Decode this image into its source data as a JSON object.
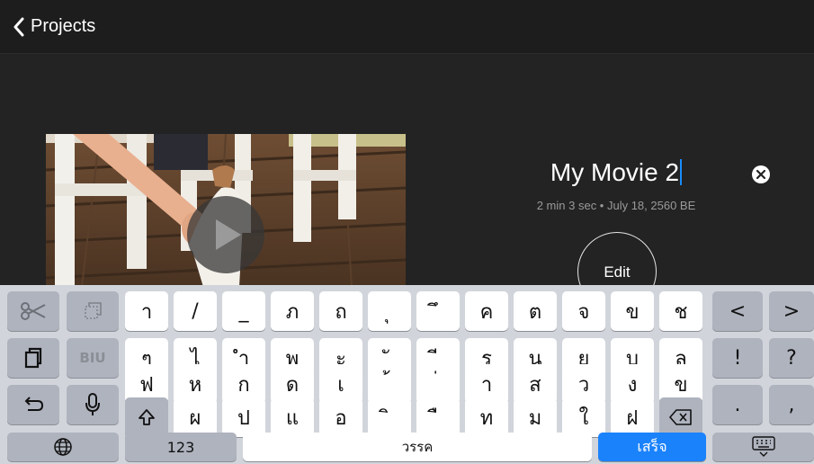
{
  "nav": {
    "back_label": "Projects"
  },
  "project": {
    "title": "My Movie 2",
    "meta": "2 min 3 sec • July 18, 2560 BE",
    "edit_label": "Edit"
  },
  "keyboard": {
    "rows": [
      [
        "า",
        "/",
        "_",
        "ภ",
        "ถ",
        "ุ",
        "ึ",
        "ค",
        "ต",
        "จ",
        "ข",
        "ช"
      ],
      [
        "ๆ",
        "ไ",
        "ำ",
        "พ",
        "ะ",
        "ั",
        "ี",
        "ร",
        "น",
        "ย",
        "บ",
        "ล"
      ],
      [
        "ฟ",
        "ห",
        "ก",
        "ด",
        "เ",
        "้",
        "่",
        "า",
        "ส",
        "ว",
        "ง",
        "ข"
      ],
      [
        "ผ",
        "ป",
        "แ",
        "อ",
        "ิ",
        "ื",
        "ท",
        "ม",
        "ใ",
        "ฝ"
      ]
    ],
    "side_keys": {
      "left_arrow": "<",
      "right_arrow": ">",
      "exclaim": "!",
      "question": "?",
      "period": ".",
      "comma": ","
    },
    "format_label": "BIU",
    "numbers_label": "123",
    "space_label": "วรรค",
    "done_label": "เสร็จ"
  },
  "colors": {
    "accent": "#1a82fb",
    "background": "#232323",
    "keyboard": "#d1d5db"
  }
}
